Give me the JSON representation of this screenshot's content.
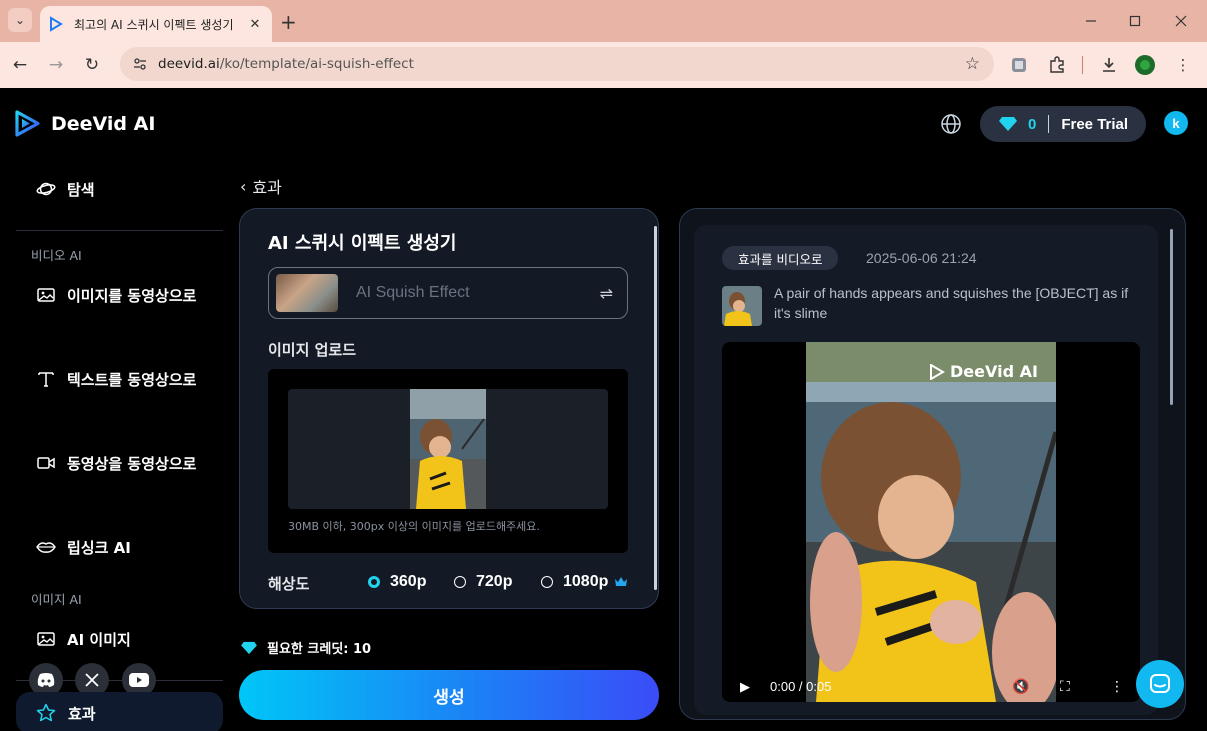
{
  "browser": {
    "tab_title": "최고의 AI 스퀴시 이펙트 생성기",
    "url_host": "deevid.ai",
    "url_path": "/ko/template/ai-squish-effect"
  },
  "header": {
    "brand": "DeeVid AI",
    "credits": "0",
    "plan": "Free Trial",
    "avatar_letter": "k"
  },
  "sidebar": {
    "explore": "탐색",
    "section_video": "비디오 AI",
    "image_to_video": "이미지를 동영상으로",
    "text_to_video": "텍스트를 동영상으로",
    "video_to_video": "동영상을 동영상으로",
    "lipsync": "립싱크 AI",
    "section_image": "이미지 AI",
    "ai_image": "AI 이미지",
    "effects": "효과"
  },
  "main": {
    "back_label": "효과",
    "title": "AI 스퀴시 이펙트 생성기",
    "effect_name": "AI Squish Effect",
    "upload_label": "이미지 업로드",
    "upload_hint": "30MB 이하, 300px 이상의 이미지를 업로드해주세요.",
    "resolution_label": "해상도",
    "resolutions": [
      "360p",
      "720p",
      "1080p"
    ],
    "selected_resolution": "360p",
    "credits_needed": "필요한 크레딧: 10",
    "generate": "생성"
  },
  "result": {
    "badge": "효과를 비디오로",
    "timestamp": "2025-06-06 21:24",
    "prompt": "A pair of hands appears and squishes the [OBJECT] as if it's slime",
    "watermark": "DeeVid AI",
    "time": "0:00 / 0:05"
  },
  "colors": {
    "accent": "#22d3ee",
    "brand_blue": "#1e7cf5",
    "panel": "#141a25"
  }
}
